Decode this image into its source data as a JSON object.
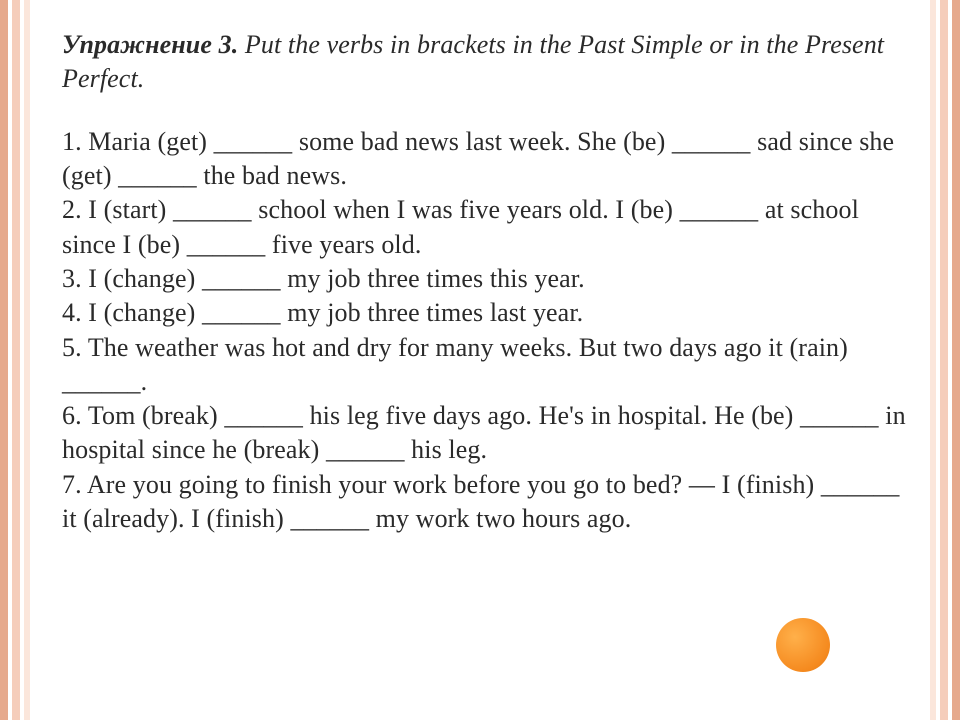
{
  "title_bold": "Упражнение 3.",
  "title_rest": " Put the verbs in brackets in the Past Simple or in the Present Perfect.",
  "items": [
    "1. Maria (get) ______ some bad news last week. She (be) ______ sad since she (get) ______  the bad news.",
    "2. I  (start) ______  school when I was five years old. I (be) ______ at school since I (be) ______  five years old.",
    "3. I  (change) ______ my job three times this year.",
    "4. I  (change) ______  my job three times last year.",
    "5.  The weather was hot and dry for many weeks. But two days ago it (rain) ______.",
    "6.  Tom (break) ______  his leg five days ago. He's in hospital. He (be) ______  in hospital since he (break) ______  his leg.",
    "7.  Are you going to finish your work before you go to bed? — I (finish) ______  it (already). I (finish) ______  my work two hours ago."
  ]
}
